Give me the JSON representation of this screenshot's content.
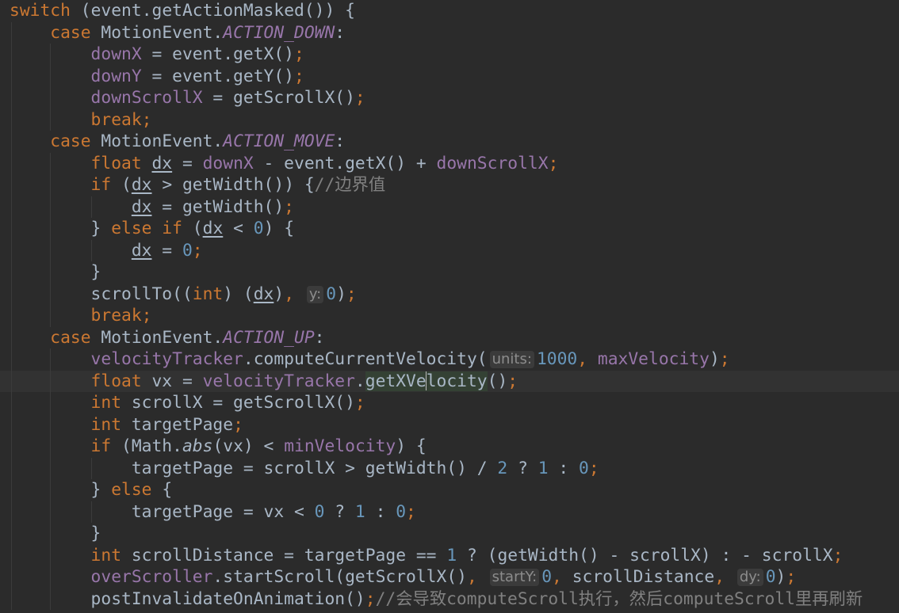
{
  "editor": {
    "theme": {
      "background": "#2b2b2b",
      "keyword": "#cc7832",
      "field": "#9876aa",
      "number": "#6897bb",
      "comment": "#808080",
      "text": "#a9b7c6"
    },
    "current_line": 18,
    "lines": [
      {
        "indent": 0,
        "tokens": [
          [
            "kw",
            "switch"
          ],
          [
            "plain",
            " (event.getActionMasked()) {"
          ]
        ]
      },
      {
        "indent": 1,
        "tokens": [
          [
            "kw",
            "case"
          ],
          [
            "plain",
            " MotionEvent."
          ],
          [
            "const",
            "ACTION_DOWN"
          ],
          [
            "plain",
            ":"
          ]
        ]
      },
      {
        "indent": 2,
        "tokens": [
          [
            "field",
            "downX"
          ],
          [
            "plain",
            " = event.getX()"
          ],
          [
            "kw",
            ";"
          ]
        ]
      },
      {
        "indent": 2,
        "tokens": [
          [
            "field",
            "downY"
          ],
          [
            "plain",
            " = event.getY()"
          ],
          [
            "kw",
            ";"
          ]
        ]
      },
      {
        "indent": 2,
        "tokens": [
          [
            "field",
            "downScrollX"
          ],
          [
            "plain",
            " = getScrollX()"
          ],
          [
            "kw",
            ";"
          ]
        ]
      },
      {
        "indent": 2,
        "tokens": [
          [
            "kw",
            "break;"
          ]
        ]
      },
      {
        "indent": 1,
        "tokens": [
          [
            "kw",
            "case"
          ],
          [
            "plain",
            " MotionEvent."
          ],
          [
            "const",
            "ACTION_MOVE"
          ],
          [
            "plain",
            ":"
          ]
        ]
      },
      {
        "indent": 2,
        "tokens": [
          [
            "kw",
            "float "
          ],
          [
            "ul",
            "dx"
          ],
          [
            "plain",
            " = "
          ],
          [
            "field",
            "downX"
          ],
          [
            "plain",
            " - event.getX() + "
          ],
          [
            "field",
            "downScrollX"
          ],
          [
            "kw",
            ";"
          ]
        ]
      },
      {
        "indent": 2,
        "tokens": [
          [
            "kw",
            "if"
          ],
          [
            "plain",
            " ("
          ],
          [
            "ul",
            "dx"
          ],
          [
            "plain",
            " > getWidth()) {"
          ],
          [
            "cmt",
            "//边界值"
          ]
        ]
      },
      {
        "indent": 3,
        "tokens": [
          [
            "ul",
            "dx"
          ],
          [
            "plain",
            " = getWidth()"
          ],
          [
            "kw",
            ";"
          ]
        ]
      },
      {
        "indent": 2,
        "tokens": [
          [
            "plain",
            "} "
          ],
          [
            "kw",
            "else if"
          ],
          [
            "plain",
            " ("
          ],
          [
            "ul",
            "dx"
          ],
          [
            "plain",
            " < "
          ],
          [
            "num",
            "0"
          ],
          [
            "plain",
            ") {"
          ]
        ]
      },
      {
        "indent": 3,
        "tokens": [
          [
            "ul",
            "dx"
          ],
          [
            "plain",
            " = "
          ],
          [
            "num",
            "0"
          ],
          [
            "kw",
            ";"
          ]
        ]
      },
      {
        "indent": 2,
        "tokens": [
          [
            "plain",
            "}"
          ]
        ]
      },
      {
        "indent": 2,
        "tokens": [
          [
            "plain",
            "scrollTo(("
          ],
          [
            "kw",
            "int"
          ],
          [
            "plain",
            ") ("
          ],
          [
            "ul",
            "dx"
          ],
          [
            "plain",
            ")"
          ],
          [
            "kw",
            ","
          ],
          [
            "plain",
            " "
          ],
          [
            "hint",
            "y:"
          ],
          [
            "num",
            "0"
          ],
          [
            "plain",
            ")"
          ],
          [
            "kw",
            ";"
          ]
        ]
      },
      {
        "indent": 2,
        "tokens": [
          [
            "kw",
            "break;"
          ]
        ]
      },
      {
        "indent": 1,
        "tokens": [
          [
            "kw",
            "case"
          ],
          [
            "plain",
            " MotionEvent."
          ],
          [
            "const",
            "ACTION_UP"
          ],
          [
            "plain",
            ":"
          ]
        ]
      },
      {
        "indent": 2,
        "tokens": [
          [
            "field",
            "velocityTracker"
          ],
          [
            "plain",
            ".computeCurrentVelocity("
          ],
          [
            "hint",
            "units:"
          ],
          [
            "num",
            "1000"
          ],
          [
            "kw",
            ","
          ],
          [
            "plain",
            " "
          ],
          [
            "field",
            "maxVelocity"
          ],
          [
            "plain",
            ")"
          ],
          [
            "kw",
            ";"
          ]
        ]
      },
      {
        "indent": 2,
        "tokens": [
          [
            "kw",
            "float"
          ],
          [
            "plain",
            " vx = "
          ],
          [
            "field",
            "velocityTracker"
          ],
          [
            "plain",
            "."
          ],
          [
            "hl",
            "getXVe"
          ],
          [
            "caret",
            ""
          ],
          [
            "hl",
            "locity"
          ],
          [
            "plain",
            "()"
          ],
          [
            "kw",
            ";"
          ]
        ]
      },
      {
        "indent": 2,
        "tokens": [
          [
            "kw",
            "int"
          ],
          [
            "plain",
            " scrollX = getScrollX()"
          ],
          [
            "kw",
            ";"
          ]
        ]
      },
      {
        "indent": 2,
        "tokens": [
          [
            "kw",
            "int"
          ],
          [
            "plain",
            " targetPage"
          ],
          [
            "kw",
            ";"
          ]
        ]
      },
      {
        "indent": 2,
        "tokens": [
          [
            "kw",
            "if"
          ],
          [
            "plain",
            " (Math."
          ],
          [
            "static",
            "abs"
          ],
          [
            "plain",
            "(vx) < "
          ],
          [
            "field",
            "minVelocity"
          ],
          [
            "plain",
            ") {"
          ]
        ]
      },
      {
        "indent": 3,
        "tokens": [
          [
            "plain",
            "targetPage = scrollX > getWidth() / "
          ],
          [
            "num",
            "2"
          ],
          [
            "plain",
            " ? "
          ],
          [
            "num",
            "1"
          ],
          [
            "plain",
            " : "
          ],
          [
            "num",
            "0"
          ],
          [
            "kw",
            ";"
          ]
        ]
      },
      {
        "indent": 2,
        "tokens": [
          [
            "plain",
            "} "
          ],
          [
            "kw",
            "else"
          ],
          [
            "plain",
            " {"
          ]
        ]
      },
      {
        "indent": 3,
        "tokens": [
          [
            "plain",
            "targetPage = vx < "
          ],
          [
            "num",
            "0"
          ],
          [
            "plain",
            " ? "
          ],
          [
            "num",
            "1"
          ],
          [
            "plain",
            " : "
          ],
          [
            "num",
            "0"
          ],
          [
            "kw",
            ";"
          ]
        ]
      },
      {
        "indent": 2,
        "tokens": [
          [
            "plain",
            "}"
          ]
        ]
      },
      {
        "indent": 2,
        "tokens": [
          [
            "kw",
            "int"
          ],
          [
            "plain",
            " scrollDistance = targetPage == "
          ],
          [
            "num",
            "1"
          ],
          [
            "plain",
            " ? (getWidth() - scrollX) : - scrollX"
          ],
          [
            "kw",
            ";"
          ]
        ]
      },
      {
        "indent": 2,
        "tokens": [
          [
            "field",
            "overScroller"
          ],
          [
            "plain",
            ".startScroll(getScrollX()"
          ],
          [
            "kw",
            ","
          ],
          [
            "plain",
            " "
          ],
          [
            "hint",
            "startY:"
          ],
          [
            "num",
            "0"
          ],
          [
            "kw",
            ","
          ],
          [
            "plain",
            " scrollDistance"
          ],
          [
            "kw",
            ","
          ],
          [
            "plain",
            " "
          ],
          [
            "hint",
            "dy:"
          ],
          [
            "num",
            "0"
          ],
          [
            "plain",
            ")"
          ],
          [
            "kw",
            ";"
          ]
        ]
      },
      {
        "indent": 2,
        "tokens": [
          [
            "plain",
            "postInvalidateOnAnimation()"
          ],
          [
            "kw",
            ";"
          ],
          [
            "cmt",
            "//会导致computeScroll执行，然后computeScroll里再刷新"
          ]
        ]
      }
    ]
  }
}
